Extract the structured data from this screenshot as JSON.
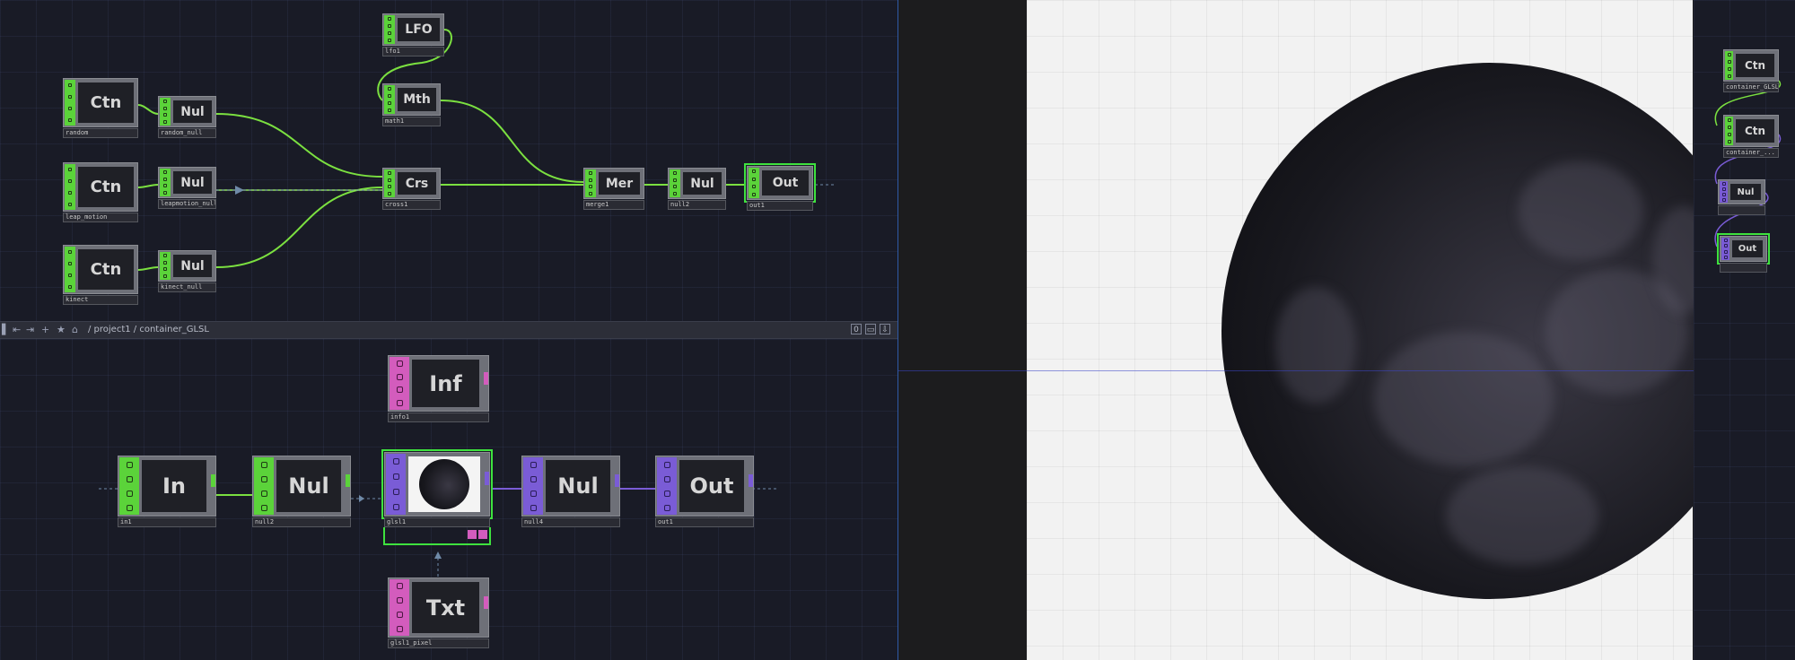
{
  "path_bar": {
    "path": "/ project1 / container_GLSL",
    "counter": "0"
  },
  "top_network": {
    "nodes": {
      "random": {
        "label": "Ctn",
        "name": "random"
      },
      "random_null": {
        "label": "Nul",
        "name": "random_null"
      },
      "leap_motion": {
        "label": "Ctn",
        "name": "leap_motion"
      },
      "leapmotion_null": {
        "label": "Nul",
        "name": "leapmotion_null"
      },
      "kinect": {
        "label": "Ctn",
        "name": "kinect"
      },
      "kinect_null": {
        "label": "Nul",
        "name": "kinect_null"
      },
      "lfo1": {
        "label": "LFO",
        "name": "lfo1"
      },
      "math1": {
        "label": "Mth",
        "name": "math1"
      },
      "cross1": {
        "label": "Crs",
        "name": "cross1"
      },
      "merge1": {
        "label": "Mer",
        "name": "merge1"
      },
      "null2": {
        "label": "Nul",
        "name": "null2"
      },
      "out1": {
        "label": "Out",
        "name": "out1"
      }
    }
  },
  "bottom_network": {
    "nodes": {
      "info1": {
        "label": "Inf",
        "name": "info1"
      },
      "in1": {
        "label": "In",
        "name": "in1"
      },
      "null2": {
        "label": "Nul",
        "name": "null2"
      },
      "glsl1": {
        "label": "",
        "name": "glsl1"
      },
      "null4": {
        "label": "Nul",
        "name": "null4"
      },
      "out1": {
        "label": "Out",
        "name": "out1"
      },
      "glsl1_pixel": {
        "label": "Txt",
        "name": "glsl1_pixel"
      }
    }
  },
  "side_network": {
    "nodes": {
      "c1": {
        "label": "Ctn",
        "name": "container_GLSL"
      },
      "c2": {
        "label": "Ctn",
        "name": "container_..."
      },
      "n1": {
        "label": "Nul",
        "name": ""
      },
      "o1": {
        "label": "Out",
        "name": ""
      }
    }
  },
  "colors": {
    "chop": "#5bd33a",
    "top": "#7a5cd6",
    "dat": "#d35cbd",
    "selection": "#3ee23e",
    "wire_chop": "#7be040",
    "wire_top": "#7a5cd6"
  },
  "icons": [
    "home-icon",
    "star-icon",
    "plus-icon",
    "back-arrow-icon",
    "forward-arrow-icon",
    "panel-icon",
    "pin-icon"
  ]
}
